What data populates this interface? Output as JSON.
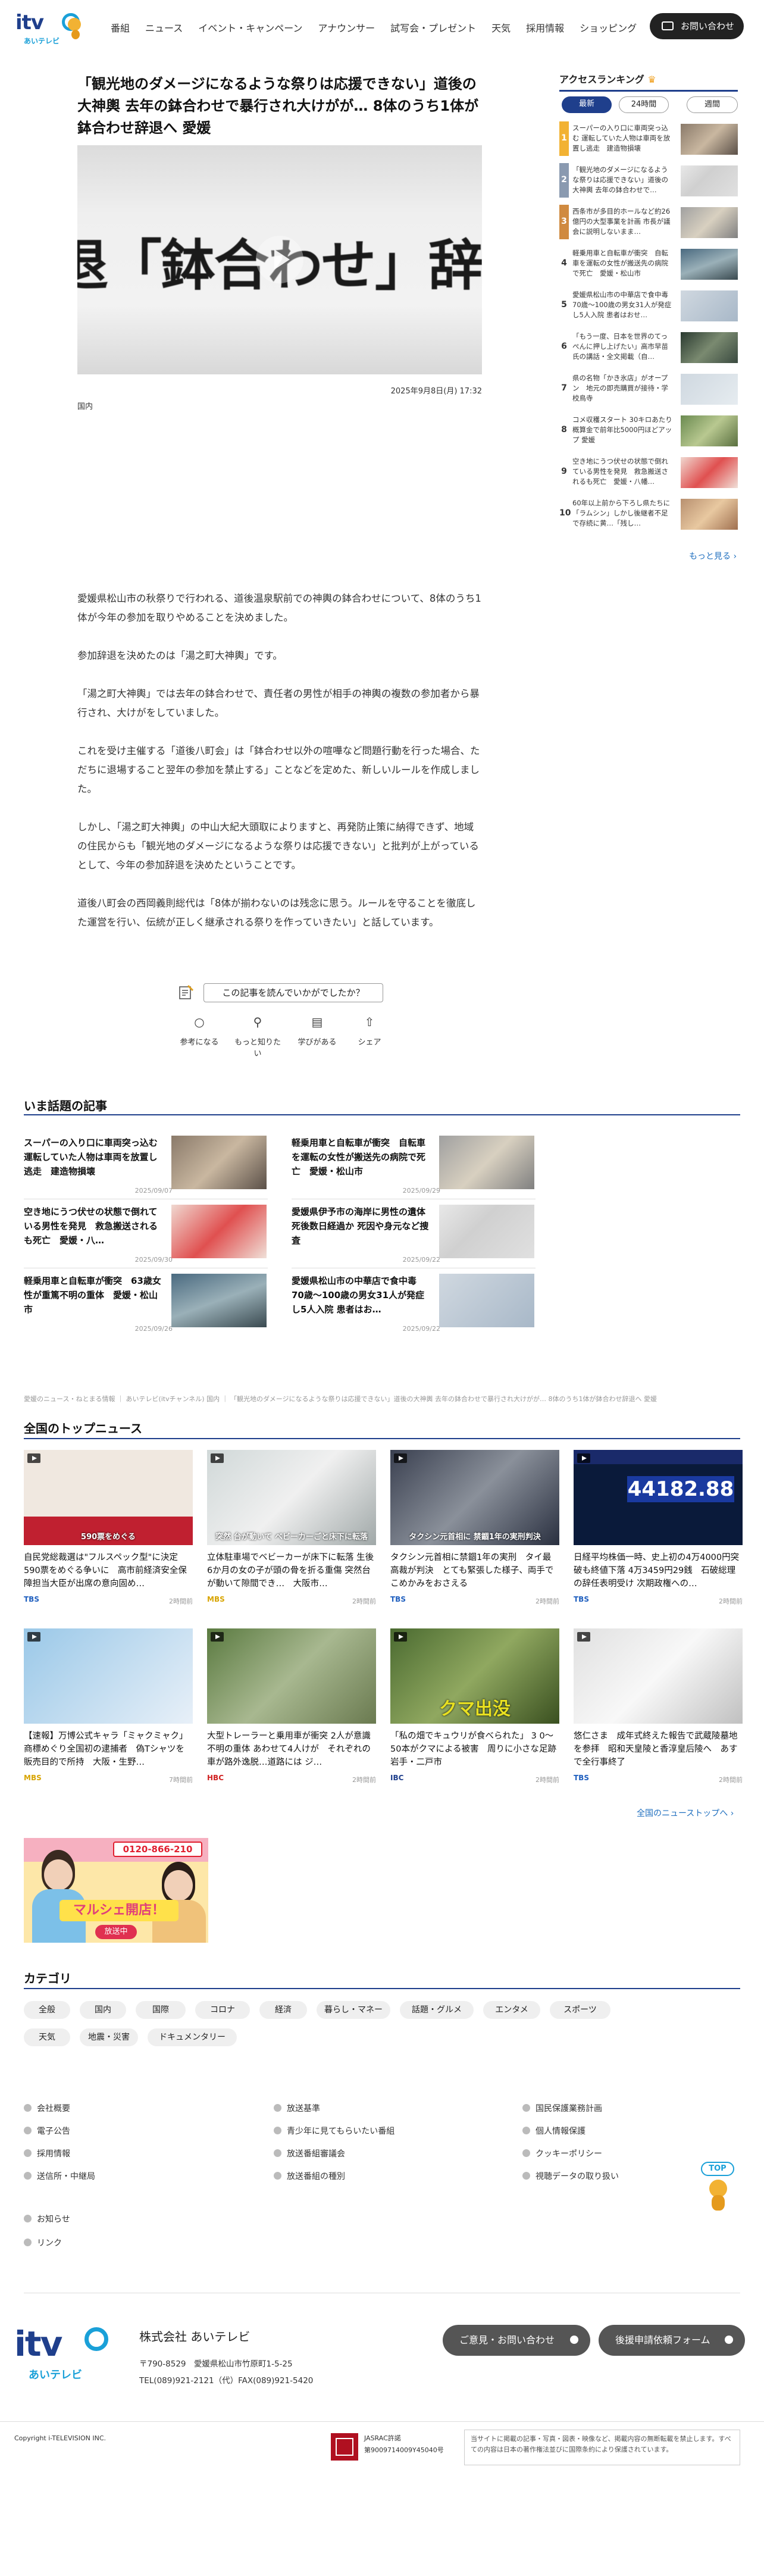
{
  "header": {
    "logo_text": "itv",
    "logo_sub": "あいテレビ",
    "nav": [
      "番組",
      "ニュース",
      "イベント・キャンペーン",
      "アナウンサー",
      "試写会・プレゼント",
      "天気",
      "採用情報",
      "ショッピング"
    ],
    "contact_label": "お問い合わせ"
  },
  "article": {
    "title": "「観光地のダメージになるような祭りは応援できない」道後の大神輿 去年の鉢合わせで暴行され大けがが… 8体のうち1体が鉢合わせ辞退へ 愛媛",
    "hero_text": "退「鉢合わせ」辞退に",
    "date": "2025年9月8日(月) 17:32",
    "category": "国内",
    "paragraphs": [
      "愛媛県松山市の秋祭りで行われる、道後温泉駅前での神輿の鉢合わせについて、8体のうち1体が今年の参加を取りやめることを決めました。",
      "参加辞退を決めたのは「湯之町大神輿」です。",
      "「湯之町大神輿」では去年の鉢合わせで、責任者の男性が相手の神輿の複数の参加者から暴行され、大けがをしていました。",
      "これを受け主催する「道後八町会」は「鉢合わせ以外の喧嘩など問題行動を行った場合、ただちに退場すること翌年の参加を禁止する」ことなどを定めた、新しいルールを作成しました。",
      "しかし、「湯之町大神輿」の中山大紀大頭取によりますと、再発防止策に納得できず、地域の住民からも「観光地のダメージになるような祭りは応援できない」と批判が上がっているとして、今年の参加辞退を決めたということです。",
      "道後八町会の西岡義則総代は「8体が揃わないのは残念に思う。ルールを守ることを徹底した運営を行い、伝統が正しく継承される祭りを作っていきたい」と話しています。"
    ],
    "feedback_question": "この記事を読んでいかがでしたか？",
    "feedback": [
      "参考になる",
      "もっと知りたい",
      "学びがある",
      "シェア"
    ]
  },
  "ranking": {
    "title": "アクセスランキング",
    "tabs": [
      "最新",
      "24時間",
      "週間"
    ],
    "items": [
      {
        "rank": "1",
        "text": "スーパーの入り口に車両突っ込む 運転していた人物は車両を放置し逃走　建造物損壊"
      },
      {
        "rank": "2",
        "text": "「観光地のダメージになるような祭りは応援できない」道後の大神輿 去年の鉢合わせで…"
      },
      {
        "rank": "3",
        "text": "西条市が多目的ホールなど約26億円の大型事業を計画 市長が議会に説明しないまま…"
      },
      {
        "rank": "4",
        "text": "軽乗用車と自転車が衝突　自転車を運転の女性が搬送先の病院で死亡　愛媛・松山市"
      },
      {
        "rank": "5",
        "text": "愛媛県松山市の中華店で食中毒　70歳～100歳の男女31人が発症し5人入院 患者はおせ…"
      },
      {
        "rank": "6",
        "text": "「もう一度、日本を世界のてっぺんに押し上げたい」高市早苗氏の講話・全文掲載（自…"
      },
      {
        "rank": "7",
        "text": "県の名物「かき氷店」がオープン　地元の即売購買が接待・学校鳥寺"
      },
      {
        "rank": "8",
        "text": "コメ収穫スタート 30キロあたり概算金で前年比5000円ほどアップ 愛媛"
      },
      {
        "rank": "9",
        "text": "空き地にうつ伏せの状態で倒れている男性を発見　救急搬送されるも死亡　愛媛・八幡…"
      },
      {
        "rank": "10",
        "text": "60年以上前から下ろし県たちに「ラムシン」しかし後継者不足で存続に黄…「残し…"
      }
    ],
    "more": "もっと見る"
  },
  "trending": {
    "title": "いま話題の記事",
    "items": [
      {
        "text": "スーパーの入り口に車両突っ込む 運転していた人物は車両を放置し逃走　建造物損壊",
        "date": "2025/09/07"
      },
      {
        "text": "軽乗用車と自転車が衝突　自転車を運転の女性が搬送先の病院で死亡　愛媛・松山市",
        "date": "2025/09/29"
      },
      {
        "text": "空き地にうつ伏せの状態で倒れている男性を発見　救急搬送されるも死亡　愛媛・八…",
        "date": "2025/09/30"
      },
      {
        "text": "愛媛県伊予市の海岸に男性の遺体 死後数日経過か 死因や身元など捜査",
        "date": "2025/09/22"
      },
      {
        "text": "軽乗用車と自転車が衝突　63歳女性が重篤不明の重体　愛媛・松山市",
        "date": "2025/09/26"
      },
      {
        "text": "愛媛県松山市の中華店で食中毒　70歳～100歳の男女31人が発症し5人入院 患者はお…",
        "date": "2025/09/22"
      }
    ]
  },
  "breadcrumb": "愛媛のニュース・ねとまる情報 ｜ あいテレビ(itvチャンネル) 国内 ｜ 「観光地のダメージになるような祭りは応援できない」道後の大神輿 去年の鉢合わせで暴行され大けがが… 8体のうち1体が鉢合わせ辞退へ 愛媛",
  "national": {
    "title": "全国のトップニュース",
    "items": [
      {
        "text": "自民党総裁選は\"フルスペック型\"に決定 590票をめぐる争いに　高市前経済安全保障担当大臣が出席の意向固め…",
        "src": "TBS",
        "src_color": "#1f5fbf",
        "date": "2時間前",
        "img_text": "590票をめぐる"
      },
      {
        "text": "立体駐車場でベビーカーが床下に転落 生後6か月の女の子が頭の骨を折る重傷 突然台が動いて隙間でき…　大阪市…",
        "src": "MBS",
        "src_color": "#d8a400",
        "date": "2時間前",
        "img_text": "突然 台が動いて ベビーカーごと床下に転落"
      },
      {
        "text": "タクシン元首相に禁錮1年の実刑　タイ最高裁が判決　とても緊張した様子、両手でこめかみをおさえる",
        "src": "TBS",
        "src_color": "#1f5fbf",
        "date": "2時間前",
        "img_text": "タクシン元首相に 禁錮1年の実刑判決"
      },
      {
        "text": "日経平均株価一時、史上初の4万4000円突破も終値下落 4万3459円29銭　石破総理の辞任表明受け 次期政権への…",
        "src": "TBS",
        "src_color": "#1f5fbf",
        "date": "2時間前",
        "img_text": "44182.88"
      },
      {
        "text": "【速報】万博公式キャラ「ミャクミャク」商標めぐり全国初の逮捕者　偽Tシャツを販売目的で所持　大阪・生野…",
        "src": "MBS",
        "src_color": "#d8a400",
        "date": "7時間前",
        "img_text": ""
      },
      {
        "text": "大型トレーラーと乗用車が衝突 2人が意識不明の重体 あわせて4人けが　それぞれの車が路外逸脱…道路には ジ…",
        "src": "HBC",
        "src_color": "#d02020",
        "date": "2時間前",
        "img_text": ""
      },
      {
        "text": "「私の畑でキュウリが食べられた」 3 0～50本がクマによる被害　周りに小さな足跡　岩手・二戸市",
        "src": "IBC",
        "src_color": "#1f3f8c",
        "date": "2時間前",
        "img_text": "クマ出没"
      },
      {
        "text": "悠仁さま　成年式終えた報告で武蔵陵墓地を参拝　昭和天皇陵と香淳皇后陵へ　あすで全行事終了",
        "src": "TBS",
        "src_color": "#1f5fbf",
        "date": "2時間前",
        "img_text": ""
      }
    ],
    "more": "全国のニューストップへ"
  },
  "banner": {
    "line1": "0120-866-210",
    "line2": "マルシェ開店！",
    "line3": "放送中"
  },
  "categories": {
    "title": "カテゴリ",
    "items": [
      "全般",
      "国内",
      "国際",
      "コロナ",
      "経済",
      "暮らし・マネー",
      "話題・グルメ",
      "エンタメ",
      "スポーツ",
      "天気",
      "地震・災害",
      "ドキュメンタリー"
    ]
  },
  "footer": {
    "col1": [
      "会社概要",
      "電子公告",
      "採用情報",
      "送信所・中継局"
    ],
    "col2": [
      "放送基準",
      "青少年に見てもらいたい番組",
      "放送番組審議会",
      "放送番組の種別"
    ],
    "col3": [
      "国民保護業務計画",
      "個人情報保護",
      "クッキーポリシー",
      "視聴データの取り扱い"
    ],
    "col4": [
      "お知らせ",
      "リンク"
    ],
    "company": "株式会社 あいテレビ",
    "address1": "〒790-8529　愛媛県松山市竹原町1-5-25",
    "address2": "TEL(089)921-2121（代）FAX(089)921-5420",
    "btn1": "ご意見・お問い合わせ",
    "btn2": "後援申請依頼フォーム",
    "copyright": "Copyright i-TELEVISION INC.",
    "jasrac1": "JASRAC許諾",
    "jasrac2": "第9009714009Y45040号",
    "notice": "当サイトに掲載の記事・写真・図表・映像など、掲載内容の無断転載を禁止します。すべての内容は日本の著作権法並びに国際条約により保護されています。",
    "top_label": "TOP"
  }
}
